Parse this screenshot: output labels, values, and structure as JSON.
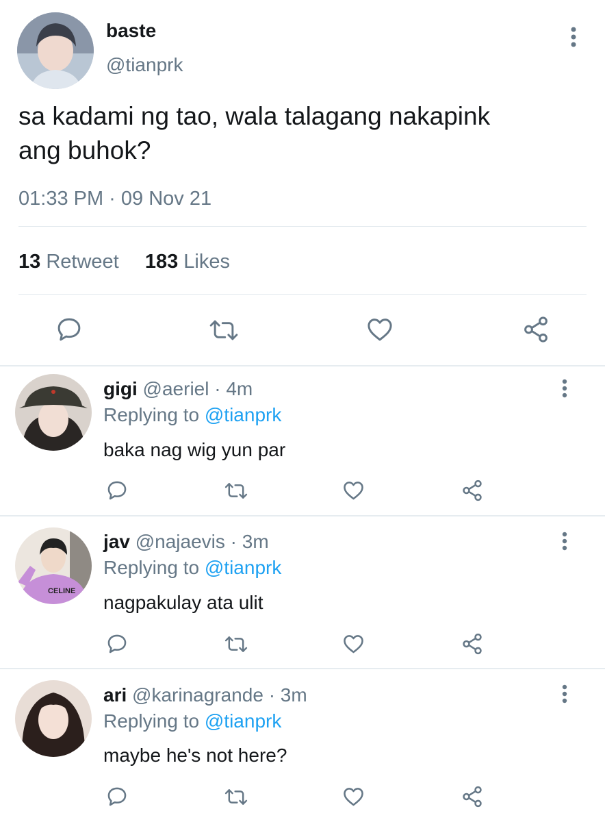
{
  "tweet": {
    "display_name": "baste",
    "handle": "@tianprk",
    "text_line1": "sa kadami ng tao, wala talagang nakapink",
    "text_line2": "ang buhok?",
    "timestamp": "01:33 PM · 09 Nov 21",
    "retweet_count": "13",
    "retweet_label": "Retweet",
    "likes_count": "183",
    "likes_label": "Likes"
  },
  "replies": [
    {
      "display_name": "gigi",
      "handle": "@aeriel",
      "time": "· 4m",
      "replying_label": "Replying to",
      "replying_to": "@tianprk",
      "text": "baka nag wig yun par"
    },
    {
      "display_name": "jav",
      "handle": "@najaevis",
      "time": "· 3m",
      "replying_label": "Replying to",
      "replying_to": "@tianprk",
      "text": "nagpakulay ata ulit",
      "avatar_shirt_text": "CELINE"
    },
    {
      "display_name": "ari",
      "handle": "@karinagrande",
      "time": "· 3m",
      "replying_label": "Replying to",
      "replying_to": "@tianprk",
      "text": "maybe he's not here?"
    }
  ],
  "icons": {
    "reply": "speech-bubble-icon",
    "retweet": "retweet-icon",
    "like": "heart-icon",
    "share": "share-nodes-icon",
    "more": "vertical-ellipsis-icon"
  },
  "colors": {
    "text": "#14171a",
    "muted": "#657786",
    "link": "#1da1f2",
    "divider": "#e1e8ed"
  }
}
